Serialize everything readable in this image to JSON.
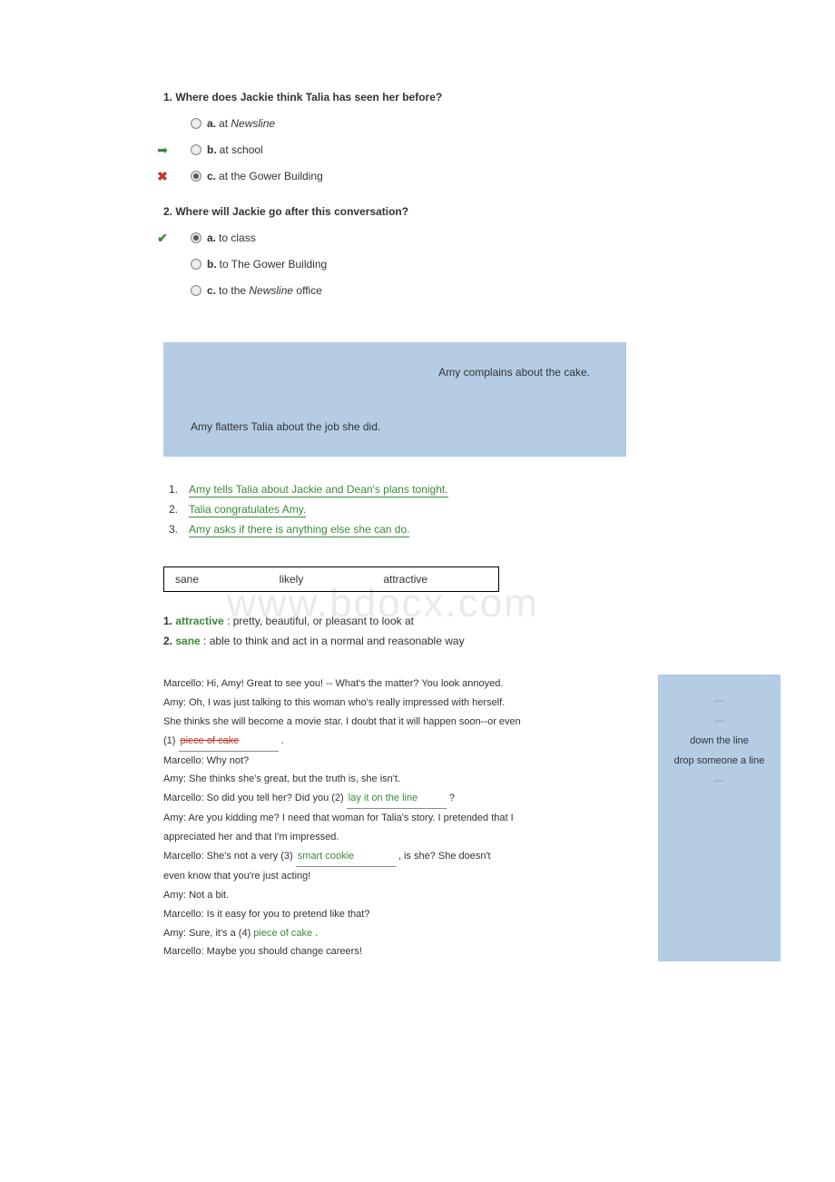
{
  "watermark": "www.bdocx.com",
  "q1": {
    "text": "Where does Jackie think Talia has seen her before?",
    "a": {
      "label": "a.",
      "text_pre": "at ",
      "text_italic": "Newsline"
    },
    "b": {
      "label": "b.",
      "text": "at school"
    },
    "c": {
      "label": "c.",
      "text": "at the Gower Building"
    }
  },
  "q2": {
    "text": "Where will Jackie go after this conversation?",
    "a": {
      "label": "a.",
      "text": "to class"
    },
    "b": {
      "label": "b.",
      "text": "to The Gower Building"
    },
    "c": {
      "label": "c.",
      "text_pre": "to the ",
      "text_italic": "Newsline",
      "text_post": " office"
    }
  },
  "bluebox": {
    "line1": "Amy complains about the cake.",
    "line2": "Amy flatters Talia about the job she did."
  },
  "ordered": {
    "n1": "1.",
    "t1": "Amy tells Talia about Jackie and Dean's plans tonight.",
    "n2": "2.",
    "t2": "Talia congratulates Amy.",
    "n3": "3.",
    "t3": "Amy asks if there is anything else she can do."
  },
  "wordbox": {
    "w1": "sane",
    "w2": "likely",
    "w3": "attractive"
  },
  "def1": {
    "num": "1.",
    "word": "attractive",
    "text": " : pretty, beautiful, or pleasant to look at"
  },
  "def2": {
    "num": "2.",
    "word": "sane",
    "text": " : able to think and act in a normal and reasonable way"
  },
  "dialogue": {
    "l1": "Marcello:  Hi, Amy! Great to see you! -- What's the matter? You look annoyed.",
    "l2": "Amy: Oh, I was just talking  to this woman who's really  impressed with herself.",
    "l3": "She thinks she will  become a movie star. I doubt that it will  happen soon--or even",
    "l4a": "(1) ",
    "blank1": "piece of cake",
    "l4b": "  .",
    "l5": "Marcello:  Why not?",
    "l6": "Amy: She thinks she's great, but the truth is, she isn't.",
    "l7a": "Marcello:  So did you tell  her? Did you (2) ",
    "blank2": "lay it on the line",
    "l7b": "  ?",
    "l8": "Amy: Are you kidding  me? I need that woman for Talia's  story. I pretended that I",
    "l9": "appreciated  her and that I'm impressed.",
    "l10a": "Marcello:  She's not a very (3) ",
    "blank3": "smart cookie",
    "l10b": "  , is she? She doesn't",
    "l11": "even know that you're just acting!",
    "l12": "Amy: Not a bit.",
    "l13": "Marcello:  Is it  easy for you to pretend like that?",
    "l14a": "Amy: Sure, it's a (4) ",
    "blank4": "piece of cake",
    "l14b": "               .",
    "l15": "Marcello:  Maybe you should change careers!"
  },
  "sidebar": {
    "s1": "down the line",
    "s2": "drop someone a line"
  }
}
